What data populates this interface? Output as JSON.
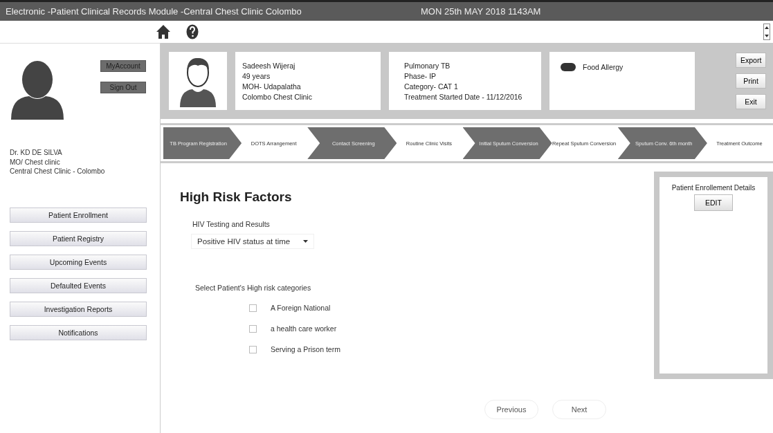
{
  "window": {
    "title": "Electronic -Patient Clinical Records Module -Central Chest Clinic Colombo",
    "datetime": "MON 25th MAY 2018 1143AM"
  },
  "user": {
    "account_button": "MyAccount",
    "signout_button": "Sign Out",
    "name": "Dr. KD DE SILVA",
    "role": "MO/ Chest clinic",
    "clinic": "Central Chest Clinic - Colombo"
  },
  "nav": [
    "Patient Enrollment",
    "Patient Registry",
    "Upcoming Events",
    "Defaulted Events",
    "Investigation Reports",
    "Notifications"
  ],
  "patient": {
    "details": [
      "Sadeesh Wijeraj",
      "49 years",
      "MOH- Udapalatha",
      "Colombo Chest Clinic"
    ],
    "treatment": [
      "Pulmonary TB",
      "Phase- IP",
      "Category- CAT 1",
      "Treatment Started Date - 11/12/2016"
    ],
    "alerts": [
      "Food Allergy"
    ],
    "actions": [
      "Export",
      "Print",
      "Exit"
    ]
  },
  "steps": [
    {
      "label": "TB Program Registration",
      "highlighted": true
    },
    {
      "label": "DOTS Arrangement",
      "highlighted": false
    },
    {
      "label": "Contact Screening",
      "highlighted": true
    },
    {
      "label": "Routine Clinic Visits",
      "highlighted": false
    },
    {
      "label": "Initial Sputum Conversion",
      "highlighted": true
    },
    {
      "label": "Repeat Sputum Conversion",
      "highlighted": false
    },
    {
      "label": "Sputum Conv. 6th month",
      "highlighted": true
    },
    {
      "label": "Treatment Outcome",
      "highlighted": false
    }
  ],
  "form": {
    "title": "High Risk Factors",
    "hiv_label": "HIV Testing and Results",
    "hiv_value": "Positive HIV status at time",
    "categories_label": "Select Patient's High risk categories",
    "categories": [
      {
        "label": "A Foreign National",
        "checked": false
      },
      {
        "label": "a health care worker",
        "checked": false
      },
      {
        "label": "Serving a Prison term",
        "checked": false
      }
    ]
  },
  "enrollment_panel": {
    "title": "Patient Enrollement Details",
    "button": "EDIT"
  },
  "footer_buttons": [
    "Previous",
    "Next"
  ]
}
